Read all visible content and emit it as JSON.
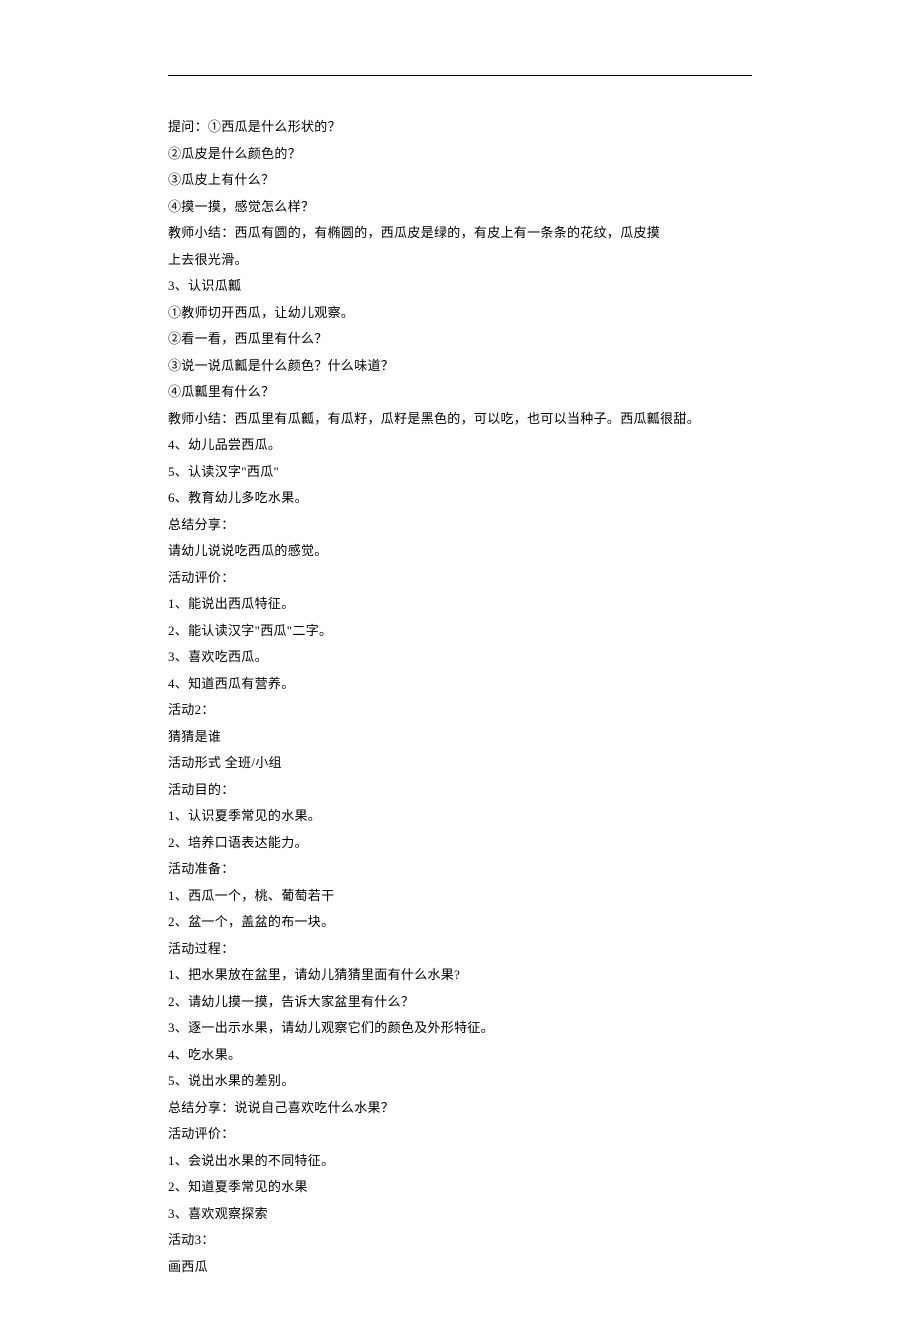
{
  "lines": [
    "提问：①西瓜是什么形状的？",
    "②瓜皮是什么颜色的？",
    "③瓜皮上有什么？",
    "④摸一摸，感觉怎么样？",
    "教师小结：西瓜有圆的，有椭圆的，西瓜皮是绿的，有皮上有一条条的花纹，瓜皮摸",
    "上去很光滑。",
    "3、认识瓜瓤",
    "①教师切开西瓜，让幼儿观察。",
    "②看一看，西瓜里有什么？",
    "③说一说瓜瓤是什么颜色？什么味道？",
    "④瓜瓤里有什么？",
    "教师小结：西瓜里有瓜瓤，有瓜籽，瓜籽是黑色的，可以吃，也可以当种子。西瓜瓤很甜。",
    "4、幼儿品尝西瓜。",
    "5、认读汉字\"西瓜\"",
    "6、教育幼儿多吃水果。",
    "总结分享：",
    "请幼儿说说吃西瓜的感觉。",
    "活动评价：",
    "1、能说出西瓜特征。",
    "2、能认读汉字\"西瓜\"二字。",
    "3、喜欢吃西瓜。",
    "4、知道西瓜有营养。",
    "活动2：",
    "猜猜是谁",
    "活动形式  全班/小组",
    "活动目的：",
    "1、认识夏季常见的水果。",
    "2、培养口语表达能力。",
    "活动准备：",
    "1、西瓜一个，桃、葡萄若干",
    "2、盆一个，盖盆的布一块。",
    "活动过程：",
    "1、把水果放在盆里，请幼儿猜猜里面有什么水果?",
    "2、请幼儿摸一摸，告诉大家盆里有什么？",
    "3、逐一出示水果，请幼儿观察它们的颜色及外形特征。",
    "4、吃水果。",
    "5、说出水果的差别。",
    "总结分享：说说自己喜欢吃什么水果？",
    "活动评价：",
    "1、会说出水果的不同特征。",
    "2、知道夏季常见的水果",
    "3、喜欢观察探索",
    "活动3：",
    "画西瓜"
  ]
}
